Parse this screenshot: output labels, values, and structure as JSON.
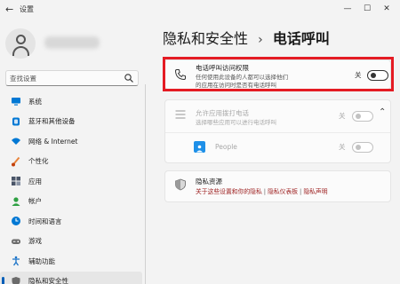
{
  "window": {
    "app_title": "设置",
    "controls": {
      "minimize": "—",
      "maximize": "☐",
      "close": "✕"
    }
  },
  "search": {
    "placeholder": "查找设置"
  },
  "sidebar": {
    "items": [
      {
        "label": "系统",
        "icon": "monitor-icon",
        "color": "#0078d4",
        "active": false
      },
      {
        "label": "蓝牙和其他设备",
        "icon": "bluetooth-icon",
        "color": "#0078d4",
        "active": false
      },
      {
        "label": "网络 & Internet",
        "icon": "wifi-icon",
        "color": "#0078d4",
        "active": false
      },
      {
        "label": "个性化",
        "icon": "brush-icon",
        "color": "#e8833a",
        "active": false
      },
      {
        "label": "应用",
        "icon": "apps-icon",
        "color": "#4a5568",
        "active": false
      },
      {
        "label": "帐户",
        "icon": "account-icon",
        "color": "#2ea043",
        "active": false
      },
      {
        "label": "时间和语言",
        "icon": "globe-clock-icon",
        "color": "#0078d4",
        "active": false
      },
      {
        "label": "游戏",
        "icon": "gamepad-icon",
        "color": "#6b6b6b",
        "active": false
      },
      {
        "label": "辅助功能",
        "icon": "accessibility-icon",
        "color": "#1a73c8",
        "active": false
      },
      {
        "label": "隐私和安全性",
        "icon": "shield-icon",
        "color": "#6b6b6b",
        "active": true
      }
    ]
  },
  "breadcrumb": {
    "parent": "隐私和安全性",
    "separator": "›",
    "current": "电话呼叫"
  },
  "settings": {
    "call_access": {
      "title": "电话呼叫访问权限",
      "desc_line1": "任何使用此设备的人都可以选择他们",
      "desc_line2": "的应用在访问时是否有电话呼叫",
      "state": "关",
      "on": false
    },
    "app_call": {
      "title": "允许应用拨打电话",
      "desc": "选择哪些应用可以进行电话呼叫",
      "state": "关",
      "on": false,
      "expanded": true
    },
    "people": {
      "name": "People",
      "state": "关",
      "on": false
    },
    "privacy": {
      "title": "隐私资源",
      "link1": "关于这些设置和你的隐私",
      "link2": "隐私仪表板",
      "link3": "隐私声明",
      "pipe": "|"
    }
  },
  "colors": {
    "accent": "#005fb8",
    "highlight_border": "#e41b23"
  }
}
